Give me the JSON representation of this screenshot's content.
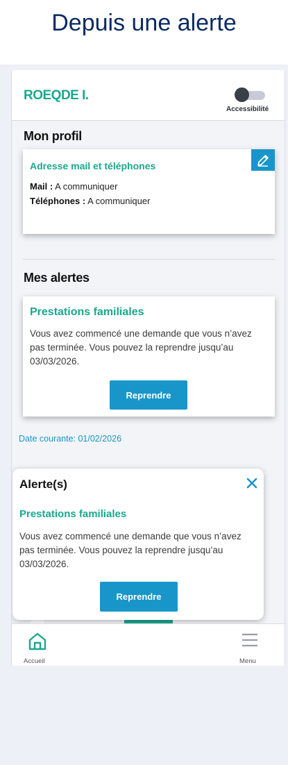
{
  "slide": {
    "title": "Depuis une alerte"
  },
  "header": {
    "user_name": "ROEQDE I.",
    "accessibility_label": "Accessibilité",
    "accessibility_enabled": false
  },
  "profile": {
    "section_title": "Mon profil",
    "card_heading": "Adresse mail et téléphones",
    "mail_label": "Mail :",
    "mail_value": " A communiquer",
    "phone_label": "Téléphones :",
    "phone_value": " A communiquer",
    "edit_icon": "pencil-icon"
  },
  "alerts": {
    "section_title": "Mes alertes",
    "heading": "Prestations familiales",
    "text": "Vous avez commencé une demande que vous n’avez pas terminée. Vous pouvez la reprendre jusqu’au 03/03/2026.",
    "button_label": "Reprendre"
  },
  "date_line": "Date courante: 01/02/2026",
  "popup": {
    "title": "Alerte(s)",
    "heading": "Prestations familiales",
    "text": "Vous avez commencé une demande que vous n’avez pas terminée. Vous pouvez la reprendre jusqu’au 03/03/2026.",
    "button_label": "Reprendre",
    "close_icon": "close-icon"
  },
  "bottom_nav": {
    "home_label": "Accueil",
    "menu_label": "Menu",
    "home_icon": "home-icon",
    "menu_icon": "hamburger-menu-icon"
  },
  "colors": {
    "brand_green": "#1aa88d",
    "accent_blue": "#1896c9",
    "title_navy": "#0b2a63"
  }
}
